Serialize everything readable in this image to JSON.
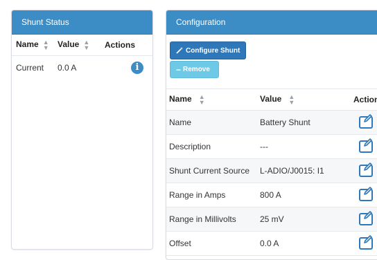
{
  "status_panel": {
    "title": "Shunt Status",
    "columns": {
      "name": "Name",
      "value": "Value",
      "actions": "Actions"
    },
    "rows": [
      {
        "name": "Current",
        "value": "0.0 A",
        "action_icon": "info-icon"
      }
    ]
  },
  "config_panel": {
    "title": "Configuration",
    "configure_button": {
      "label": "Configure Shunt",
      "icon": "wand-icon"
    },
    "remove_button": {
      "label": "Remove",
      "icon": "minus-icon"
    },
    "columns": {
      "name": "Name",
      "value": "Value",
      "actions": "Actions"
    },
    "rows": [
      {
        "name": "Name",
        "value": "Battery Shunt"
      },
      {
        "name": "Description",
        "value": "---"
      },
      {
        "name": "Shunt Current Source",
        "value": "L-ADIO/J0015: I1"
      },
      {
        "name": "Range in Amps",
        "value": "800 A"
      },
      {
        "name": "Range in Millivolts",
        "value": "25 mV"
      },
      {
        "name": "Offset",
        "value": "0.0 A"
      }
    ],
    "row_action_icon": "edit-icon"
  },
  "colors": {
    "header_blue": "#3c8dc6",
    "primary_button": "#2e77b8",
    "info_button": "#6ec9e6"
  }
}
